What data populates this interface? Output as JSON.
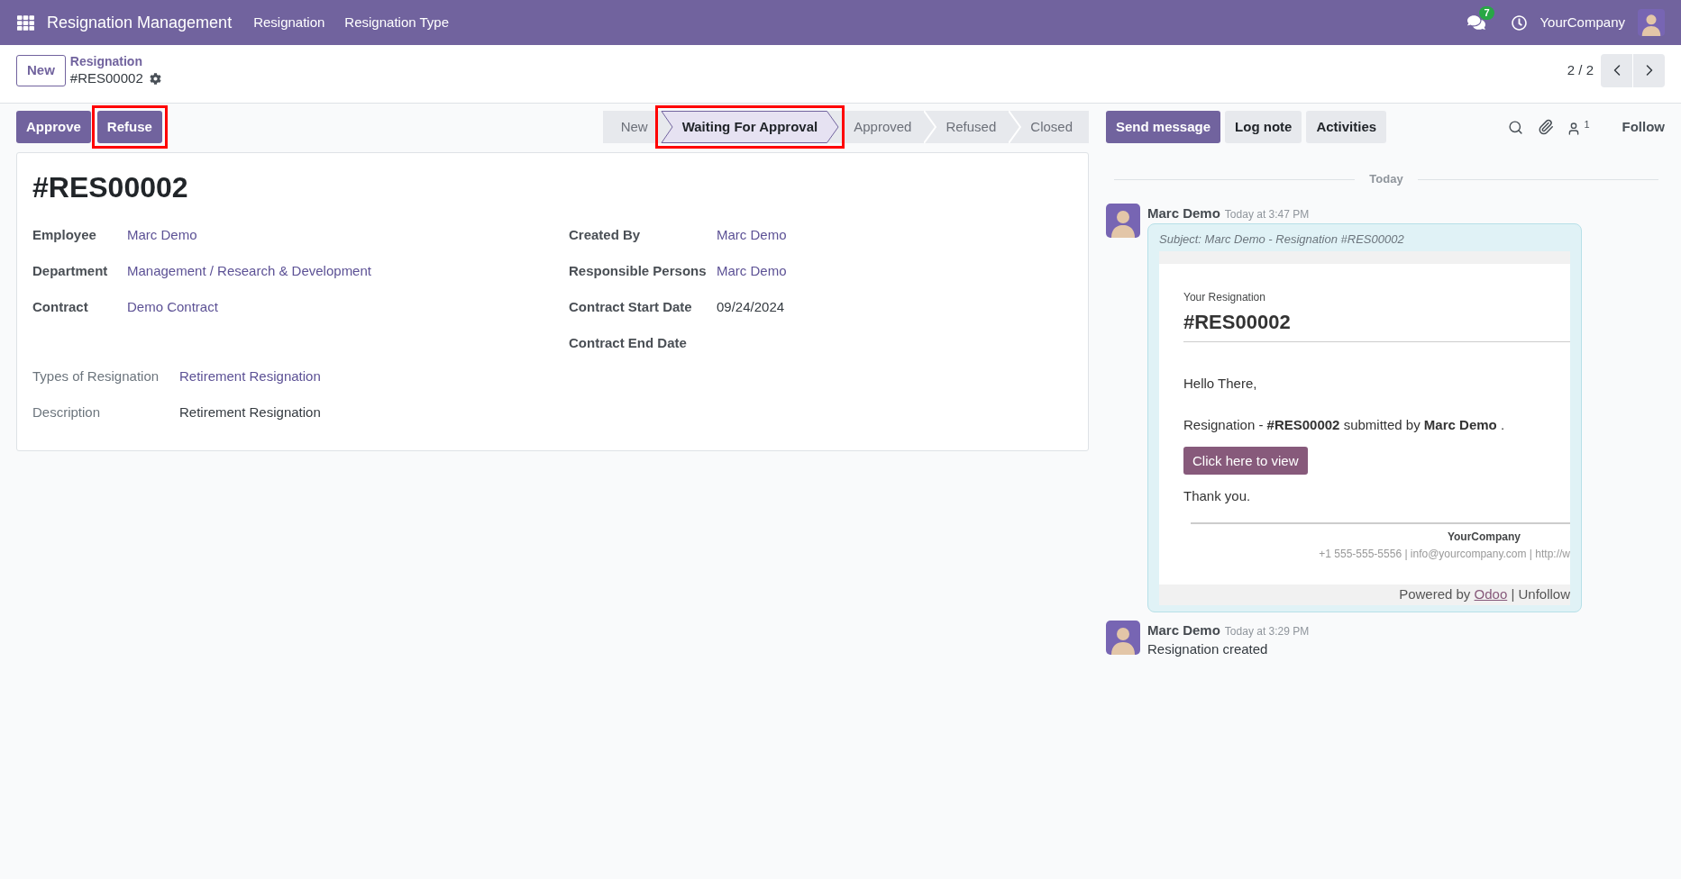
{
  "navbar": {
    "app_title": "Resignation Management",
    "menu": [
      "Resignation",
      "Resignation Type"
    ],
    "messages_badge": "7",
    "company": "YourCompany"
  },
  "control_panel": {
    "new_button": "New",
    "breadcrumb": "Resignation",
    "record_name": "#RES00002",
    "pager": "2 / 2"
  },
  "actions": [
    {
      "label": "Approve",
      "highlighted": false
    },
    {
      "label": "Refuse",
      "highlighted": true
    }
  ],
  "statusbar": [
    {
      "label": "New",
      "selected": false,
      "highlighted": false
    },
    {
      "label": "Waiting For Approval",
      "selected": true,
      "highlighted": true
    },
    {
      "label": "Approved",
      "selected": false,
      "highlighted": false
    },
    {
      "label": "Refused",
      "selected": false,
      "highlighted": false
    },
    {
      "label": "Closed",
      "selected": false,
      "highlighted": false
    }
  ],
  "form": {
    "title": "#RES00002",
    "left_fields": [
      {
        "label": "Employee",
        "value": "Marc Demo",
        "kind": "link"
      },
      {
        "label": "Department",
        "value": "Management / Research & Development",
        "kind": "link"
      },
      {
        "label": "Contract",
        "value": "Demo Contract",
        "kind": "link"
      }
    ],
    "right_fields": [
      {
        "label": "Created By",
        "value": "Marc Demo",
        "kind": "link"
      },
      {
        "label": "Responsible Persons",
        "value": "Marc Demo",
        "kind": "link"
      },
      {
        "label": "Contract Start Date",
        "value": "09/24/2024",
        "kind": "text"
      },
      {
        "label": "Contract End Date"
      }
    ],
    "detail_fields": [
      {
        "label": "Types of Resignation",
        "value": "Retirement Resignation",
        "kind": "link"
      },
      {
        "label": "Description",
        "value": "Retirement Resignation",
        "kind": "text"
      }
    ]
  },
  "chatter": {
    "buttons": [
      {
        "label": "Send message",
        "kind": "primary"
      },
      {
        "label": "Log note",
        "kind": "secondary"
      },
      {
        "label": "Activities",
        "kind": "secondary"
      }
    ],
    "followers_count": "1",
    "follow": "Follow",
    "date_separator": "Today",
    "messages": [
      {
        "kind": "email",
        "author": "Marc Demo",
        "time": "Today at 3:47 PM",
        "subject": "Subject: Marc Demo - Resignation #RES00002",
        "email": {
          "eyebrow": "Your Resignation",
          "heading": "#RES00002",
          "greeting": "Hello There,",
          "body": "Resignation - **#RES00002** submitted by **Marc Demo** .",
          "button": "Click here to view",
          "closing": "Thank you.",
          "company": "YourCompany",
          "contact": "+1 555-555-5556 | info@yourcompany.com | http://w",
          "footer_prefix": "Powered by",
          "footer_link": "Odoo",
          "footer_suffix": "| Unfollow"
        }
      },
      {
        "kind": "note",
        "author": "Marc Demo",
        "time": "Today at 3:29 PM",
        "body": "Resignation created"
      }
    ]
  }
}
